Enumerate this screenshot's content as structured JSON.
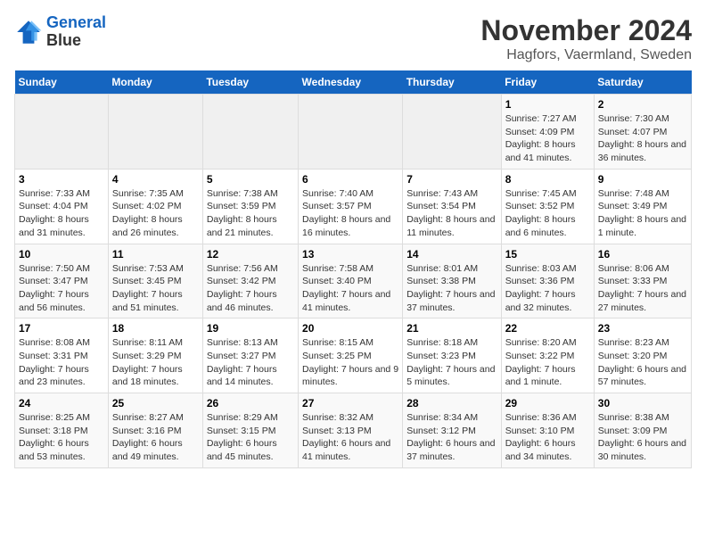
{
  "logo": {
    "line1": "General",
    "line2": "Blue"
  },
  "title": "November 2024",
  "subtitle": "Hagfors, Vaermland, Sweden",
  "headers": [
    "Sunday",
    "Monday",
    "Tuesday",
    "Wednesday",
    "Thursday",
    "Friday",
    "Saturday"
  ],
  "weeks": [
    [
      {
        "day": "",
        "info": ""
      },
      {
        "day": "",
        "info": ""
      },
      {
        "day": "",
        "info": ""
      },
      {
        "day": "",
        "info": ""
      },
      {
        "day": "",
        "info": ""
      },
      {
        "day": "1",
        "info": "Sunrise: 7:27 AM\nSunset: 4:09 PM\nDaylight: 8 hours and 41 minutes."
      },
      {
        "day": "2",
        "info": "Sunrise: 7:30 AM\nSunset: 4:07 PM\nDaylight: 8 hours and 36 minutes."
      }
    ],
    [
      {
        "day": "3",
        "info": "Sunrise: 7:33 AM\nSunset: 4:04 PM\nDaylight: 8 hours and 31 minutes."
      },
      {
        "day": "4",
        "info": "Sunrise: 7:35 AM\nSunset: 4:02 PM\nDaylight: 8 hours and 26 minutes."
      },
      {
        "day": "5",
        "info": "Sunrise: 7:38 AM\nSunset: 3:59 PM\nDaylight: 8 hours and 21 minutes."
      },
      {
        "day": "6",
        "info": "Sunrise: 7:40 AM\nSunset: 3:57 PM\nDaylight: 8 hours and 16 minutes."
      },
      {
        "day": "7",
        "info": "Sunrise: 7:43 AM\nSunset: 3:54 PM\nDaylight: 8 hours and 11 minutes."
      },
      {
        "day": "8",
        "info": "Sunrise: 7:45 AM\nSunset: 3:52 PM\nDaylight: 8 hours and 6 minutes."
      },
      {
        "day": "9",
        "info": "Sunrise: 7:48 AM\nSunset: 3:49 PM\nDaylight: 8 hours and 1 minute."
      }
    ],
    [
      {
        "day": "10",
        "info": "Sunrise: 7:50 AM\nSunset: 3:47 PM\nDaylight: 7 hours and 56 minutes."
      },
      {
        "day": "11",
        "info": "Sunrise: 7:53 AM\nSunset: 3:45 PM\nDaylight: 7 hours and 51 minutes."
      },
      {
        "day": "12",
        "info": "Sunrise: 7:56 AM\nSunset: 3:42 PM\nDaylight: 7 hours and 46 minutes."
      },
      {
        "day": "13",
        "info": "Sunrise: 7:58 AM\nSunset: 3:40 PM\nDaylight: 7 hours and 41 minutes."
      },
      {
        "day": "14",
        "info": "Sunrise: 8:01 AM\nSunset: 3:38 PM\nDaylight: 7 hours and 37 minutes."
      },
      {
        "day": "15",
        "info": "Sunrise: 8:03 AM\nSunset: 3:36 PM\nDaylight: 7 hours and 32 minutes."
      },
      {
        "day": "16",
        "info": "Sunrise: 8:06 AM\nSunset: 3:33 PM\nDaylight: 7 hours and 27 minutes."
      }
    ],
    [
      {
        "day": "17",
        "info": "Sunrise: 8:08 AM\nSunset: 3:31 PM\nDaylight: 7 hours and 23 minutes."
      },
      {
        "day": "18",
        "info": "Sunrise: 8:11 AM\nSunset: 3:29 PM\nDaylight: 7 hours and 18 minutes."
      },
      {
        "day": "19",
        "info": "Sunrise: 8:13 AM\nSunset: 3:27 PM\nDaylight: 7 hours and 14 minutes."
      },
      {
        "day": "20",
        "info": "Sunrise: 8:15 AM\nSunset: 3:25 PM\nDaylight: 7 hours and 9 minutes."
      },
      {
        "day": "21",
        "info": "Sunrise: 8:18 AM\nSunset: 3:23 PM\nDaylight: 7 hours and 5 minutes."
      },
      {
        "day": "22",
        "info": "Sunrise: 8:20 AM\nSunset: 3:22 PM\nDaylight: 7 hours and 1 minute."
      },
      {
        "day": "23",
        "info": "Sunrise: 8:23 AM\nSunset: 3:20 PM\nDaylight: 6 hours and 57 minutes."
      }
    ],
    [
      {
        "day": "24",
        "info": "Sunrise: 8:25 AM\nSunset: 3:18 PM\nDaylight: 6 hours and 53 minutes."
      },
      {
        "day": "25",
        "info": "Sunrise: 8:27 AM\nSunset: 3:16 PM\nDaylight: 6 hours and 49 minutes."
      },
      {
        "day": "26",
        "info": "Sunrise: 8:29 AM\nSunset: 3:15 PM\nDaylight: 6 hours and 45 minutes."
      },
      {
        "day": "27",
        "info": "Sunrise: 8:32 AM\nSunset: 3:13 PM\nDaylight: 6 hours and 41 minutes."
      },
      {
        "day": "28",
        "info": "Sunrise: 8:34 AM\nSunset: 3:12 PM\nDaylight: 6 hours and 37 minutes."
      },
      {
        "day": "29",
        "info": "Sunrise: 8:36 AM\nSunset: 3:10 PM\nDaylight: 6 hours and 34 minutes."
      },
      {
        "day": "30",
        "info": "Sunrise: 8:38 AM\nSunset: 3:09 PM\nDaylight: 6 hours and 30 minutes."
      }
    ]
  ]
}
